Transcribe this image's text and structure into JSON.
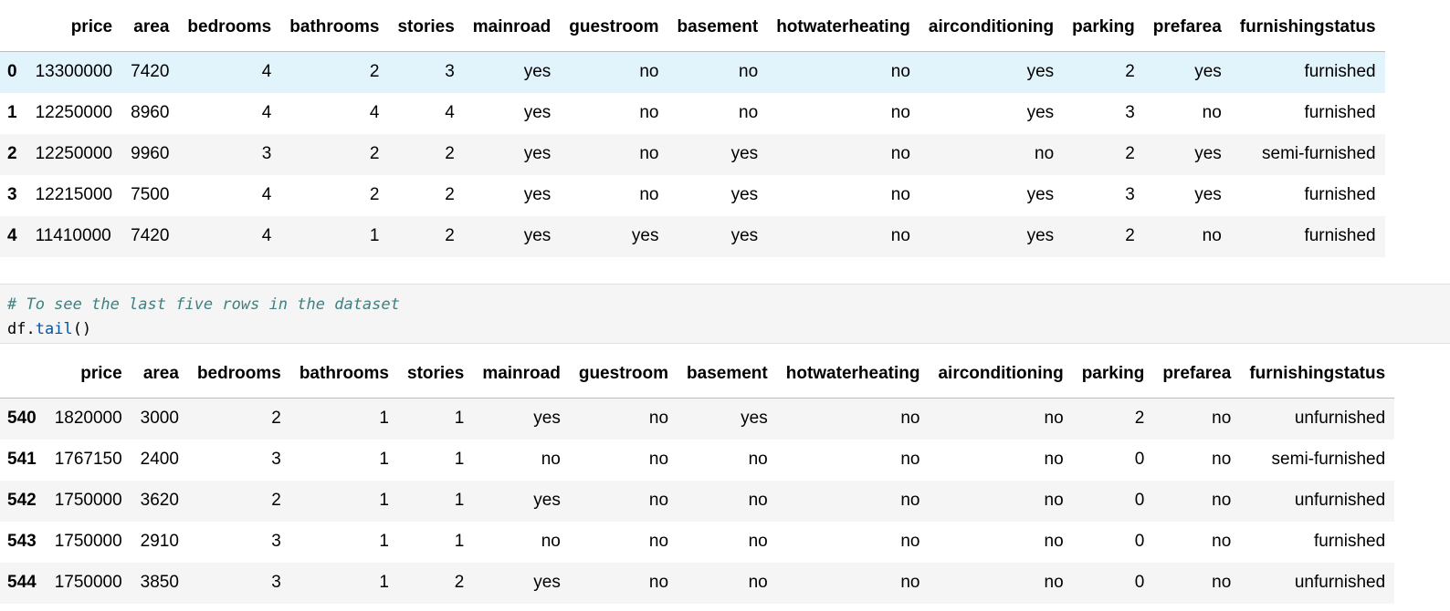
{
  "columns": [
    "",
    "price",
    "area",
    "bedrooms",
    "bathrooms",
    "stories",
    "mainroad",
    "guestroom",
    "basement",
    "hotwaterheating",
    "airconditioning",
    "parking",
    "prefarea",
    "furnishingstatus"
  ],
  "head_rows": [
    [
      "0",
      "13300000",
      "7420",
      "4",
      "2",
      "3",
      "yes",
      "no",
      "no",
      "no",
      "yes",
      "2",
      "yes",
      "furnished"
    ],
    [
      "1",
      "12250000",
      "8960",
      "4",
      "4",
      "4",
      "yes",
      "no",
      "no",
      "no",
      "yes",
      "3",
      "no",
      "furnished"
    ],
    [
      "2",
      "12250000",
      "9960",
      "3",
      "2",
      "2",
      "yes",
      "no",
      "yes",
      "no",
      "no",
      "2",
      "yes",
      "semi-furnished"
    ],
    [
      "3",
      "12215000",
      "7500",
      "4",
      "2",
      "2",
      "yes",
      "no",
      "yes",
      "no",
      "yes",
      "3",
      "yes",
      "furnished"
    ],
    [
      "4",
      "11410000",
      "7420",
      "4",
      "1",
      "2",
      "yes",
      "yes",
      "yes",
      "no",
      "yes",
      "2",
      "no",
      "furnished"
    ]
  ],
  "code_cell": {
    "comment": "# To see the last five rows in the dataset",
    "obj": "df",
    "dot": ".",
    "method": "tail",
    "parens": "()"
  },
  "tail_rows": [
    [
      "540",
      "1820000",
      "3000",
      "2",
      "1",
      "1",
      "yes",
      "no",
      "yes",
      "no",
      "no",
      "2",
      "no",
      "unfurnished"
    ],
    [
      "541",
      "1767150",
      "2400",
      "3",
      "1",
      "1",
      "no",
      "no",
      "no",
      "no",
      "no",
      "0",
      "no",
      "semi-furnished"
    ],
    [
      "542",
      "1750000",
      "3620",
      "2",
      "1",
      "1",
      "yes",
      "no",
      "no",
      "no",
      "no",
      "0",
      "no",
      "unfurnished"
    ],
    [
      "543",
      "1750000",
      "2910",
      "3",
      "1",
      "1",
      "no",
      "no",
      "no",
      "no",
      "no",
      "0",
      "no",
      "furnished"
    ],
    [
      "544",
      "1750000",
      "3850",
      "3",
      "1",
      "2",
      "yes",
      "no",
      "no",
      "no",
      "no",
      "0",
      "no",
      "unfurnished"
    ]
  ],
  "colors": {
    "row_hover": "#e1f3fb",
    "row_stripe": "#f5f5f5",
    "comment": "#408080",
    "method": "#0055aa"
  }
}
